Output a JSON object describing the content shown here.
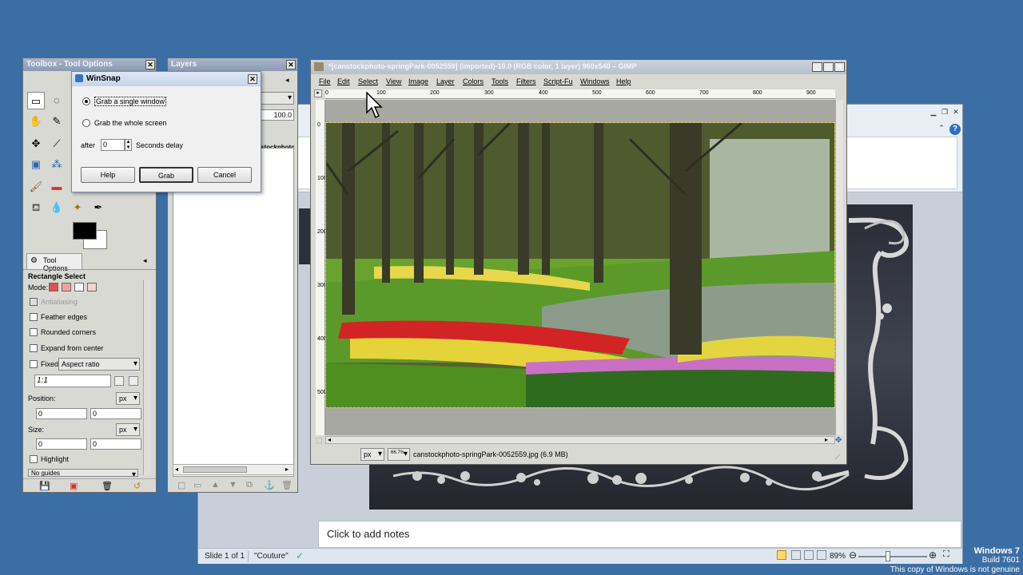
{
  "powerpoint": {
    "notes_placeholder": "Click to add notes",
    "status": {
      "slide": "Slide 1 of 1",
      "theme": "\"Couture\"",
      "zoom": "89%"
    },
    "help_icon": "?"
  },
  "watermark": {
    "line1": "Windows 7",
    "line2": "Build 7601",
    "line3": "This copy of Windows is not genuine"
  },
  "toolbox": {
    "title": "Toolbox - Tool Options",
    "tool_options_tab": "Tool Options",
    "tool_name": "Rectangle Select",
    "mode_label": "Mode:",
    "antialiasing": "Antialiasing",
    "feather_edges": "Feather edges",
    "rounded_corners": "Rounded corners",
    "expand_from_center": "Expand from center",
    "fixed_label": "Fixed:",
    "fixed_value": "Aspect ratio",
    "ratio_value": "1:1",
    "position_label": "Position:",
    "position_unit": "px",
    "position_x": "0",
    "position_y": "0",
    "size_label": "Size:",
    "size_unit": "px",
    "size_w": "0",
    "size_h": "0",
    "highlight": "Highlight",
    "guides_value": "No guides"
  },
  "layers": {
    "title": "Layers",
    "opacity": "100.0",
    "layer_name_fragment": "stockphoto-"
  },
  "winsnap": {
    "title": "WinSnap",
    "option_window": "Grab a single window",
    "option_screen": "Grab the whole screen",
    "after_label": "after",
    "delay_value": "0",
    "delay_suffix": "Seconds delay",
    "help_button": "Help",
    "grab_button": "Grab",
    "cancel_button": "Cancel"
  },
  "gimp_image": {
    "title": "*[canstockphoto-springPark-0052559] (imported)-10.0 (RGB color, 1 layer) 960x540 – GIMP",
    "menus": [
      "File",
      "Edit",
      "Select",
      "View",
      "Image",
      "Layer",
      "Colors",
      "Tools",
      "Filters",
      "Script-Fu",
      "Windows",
      "Help"
    ],
    "ruler_ticks": [
      "0",
      "100",
      "200",
      "300",
      "400",
      "500",
      "600",
      "700",
      "800",
      "900"
    ],
    "unit": "px",
    "zoom": "66.7%",
    "status_text": "canstockphoto-springPark-0052559.jpg (6.9 MB)"
  }
}
